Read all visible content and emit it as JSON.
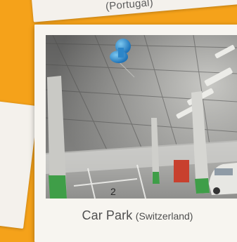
{
  "top_card": {
    "caption": "(Portugal)"
  },
  "main_card": {
    "title": "Car Park",
    "location": "(Switzerland)",
    "photo_marker": "2"
  }
}
